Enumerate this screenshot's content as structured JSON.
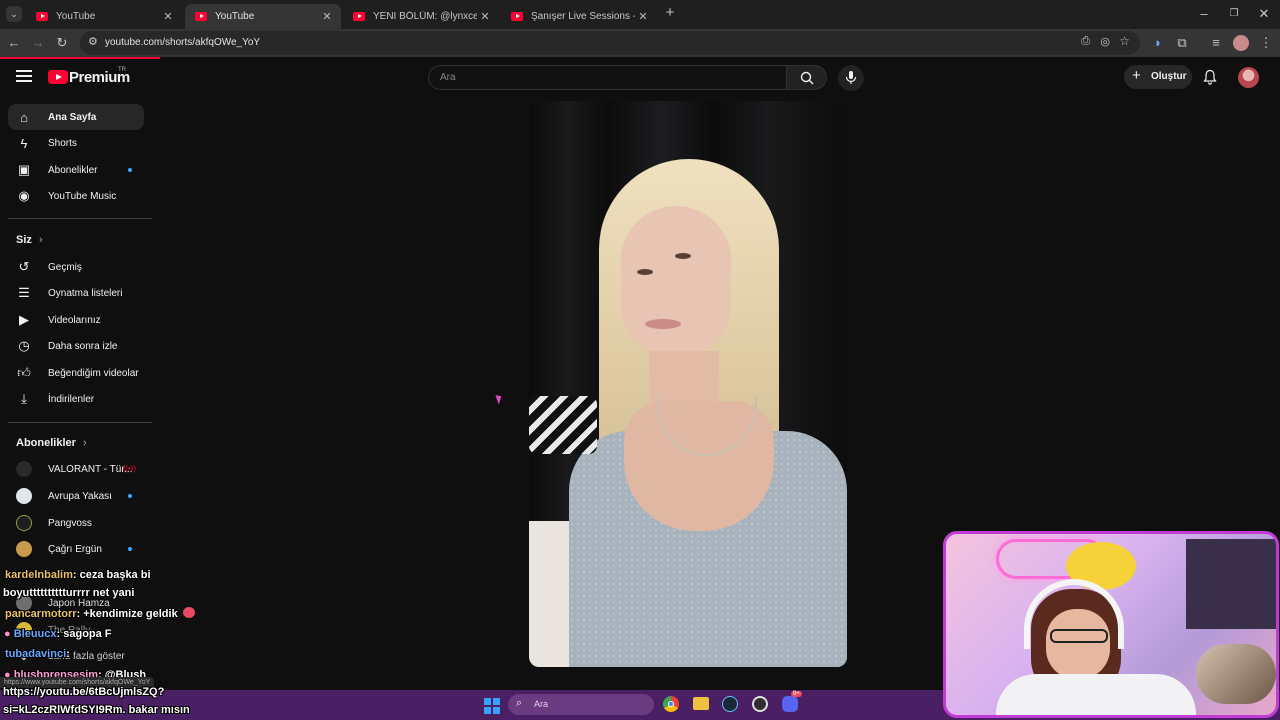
{
  "browser": {
    "tabs": [
      {
        "label": "YouTube",
        "active": false
      },
      {
        "label": "YouTube",
        "active": true
      },
      {
        "label": "YENİ BÖLÜM: @lynxcerezz, @v",
        "active": false
      },
      {
        "label": "Şanışer Live Sessions - Çaresiz Y",
        "active": false
      }
    ],
    "url": "youtube.com/shorts/akfqOWe_YoY",
    "new_tab": "+",
    "status_url": "https://www.youtube.com/shorts/akfqOWe_YoY"
  },
  "youtube": {
    "logo_text": "Premium",
    "logo_badge": "TR",
    "search_placeholder": "Ara",
    "create_label": "Oluştur",
    "nav": [
      {
        "label": "Ana Sayfa",
        "icon": "home-icon"
      },
      {
        "label": "Shorts",
        "icon": "shorts-icon"
      },
      {
        "label": "Abonelikler",
        "icon": "subscriptions-icon"
      },
      {
        "label": "YouTube Music",
        "icon": "music-icon"
      }
    ],
    "you_heading": "Siz",
    "you_items": [
      {
        "label": "Geçmiş",
        "icon": "history-icon"
      },
      {
        "label": "Oynatma listeleri",
        "icon": "playlist-icon"
      },
      {
        "label": "Videolarınız",
        "icon": "your-videos-icon"
      },
      {
        "label": "Daha sonra izle",
        "icon": "watch-later-icon"
      },
      {
        "label": "Beğendiğim videolar",
        "icon": "like-icon"
      },
      {
        "label": "İndirilenler",
        "icon": "download-icon"
      }
    ],
    "subs_heading": "Abonelikler",
    "subs": [
      {
        "label": "VALORANT - Tür...",
        "color": "#2a2a2a"
      },
      {
        "label": "Avrupa Yakası",
        "color": "#dfe6ee"
      },
      {
        "label": "Pangvoss",
        "color": "#1e1e1e"
      },
      {
        "label": "Çağrı Ergün",
        "color": "#c69a4a"
      },
      {
        "label": "Japon Hamza",
        "color": "#6e6e6e"
      },
      {
        "label": "The Rally",
        "color": "#d8b93a"
      }
    ],
    "show_more": "daha fazla göster"
  },
  "chat": [
    {
      "user": "kardelnbalim",
      "text": ": ceza başka bi"
    },
    {
      "user": "",
      "text": "boyutttttttttturrrr net yani"
    },
    {
      "user": "pancarmotorr",
      "text": ": +kendimize geldik"
    },
    {
      "user": "Bleuucx",
      "text": ": sagopa F"
    },
    {
      "user": "tubadavinci",
      "text": ":"
    },
    {
      "user": "blushprensesim",
      "text": ": @Blush"
    },
    {
      "user": "",
      "text": "https://youtu.be/6tBcUjmlsZQ?"
    },
    {
      "user": "",
      "text": "si=kL2czRlWfdSYI9Rm. bakar mısın"
    }
  ],
  "taskbar": {
    "search_placeholder": "Ara",
    "badge": "9+"
  },
  "colors": {
    "accent": "#ff0033",
    "taskbar": "#4b1f63",
    "webcam_border": "#c23bd4"
  }
}
